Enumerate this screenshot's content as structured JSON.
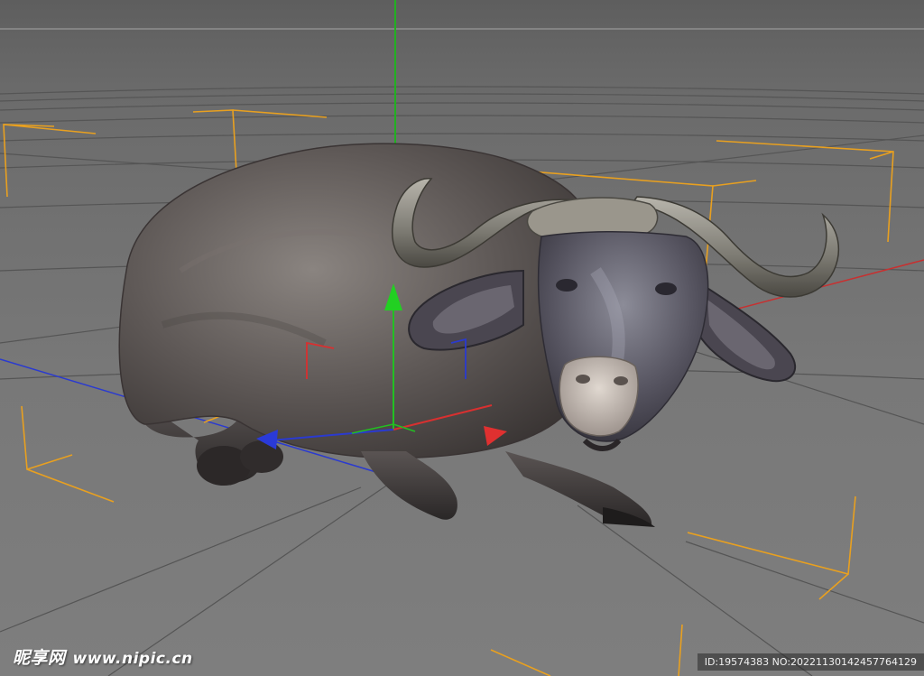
{
  "viewport": {
    "background_color": "#7a7a7a",
    "grid_color": "#5a5a5a",
    "axis_colors": {
      "x": "#d03030",
      "y": "#22b022",
      "z": "#2a3ad0"
    },
    "bounding_box_color": "#e8a020",
    "object": "water-buffalo-3d-model"
  },
  "watermark": {
    "brand": "昵享网",
    "site": "www.nipic.cn"
  },
  "image_id": {
    "text": "ID:19574383 NO:20221130142457764129"
  }
}
